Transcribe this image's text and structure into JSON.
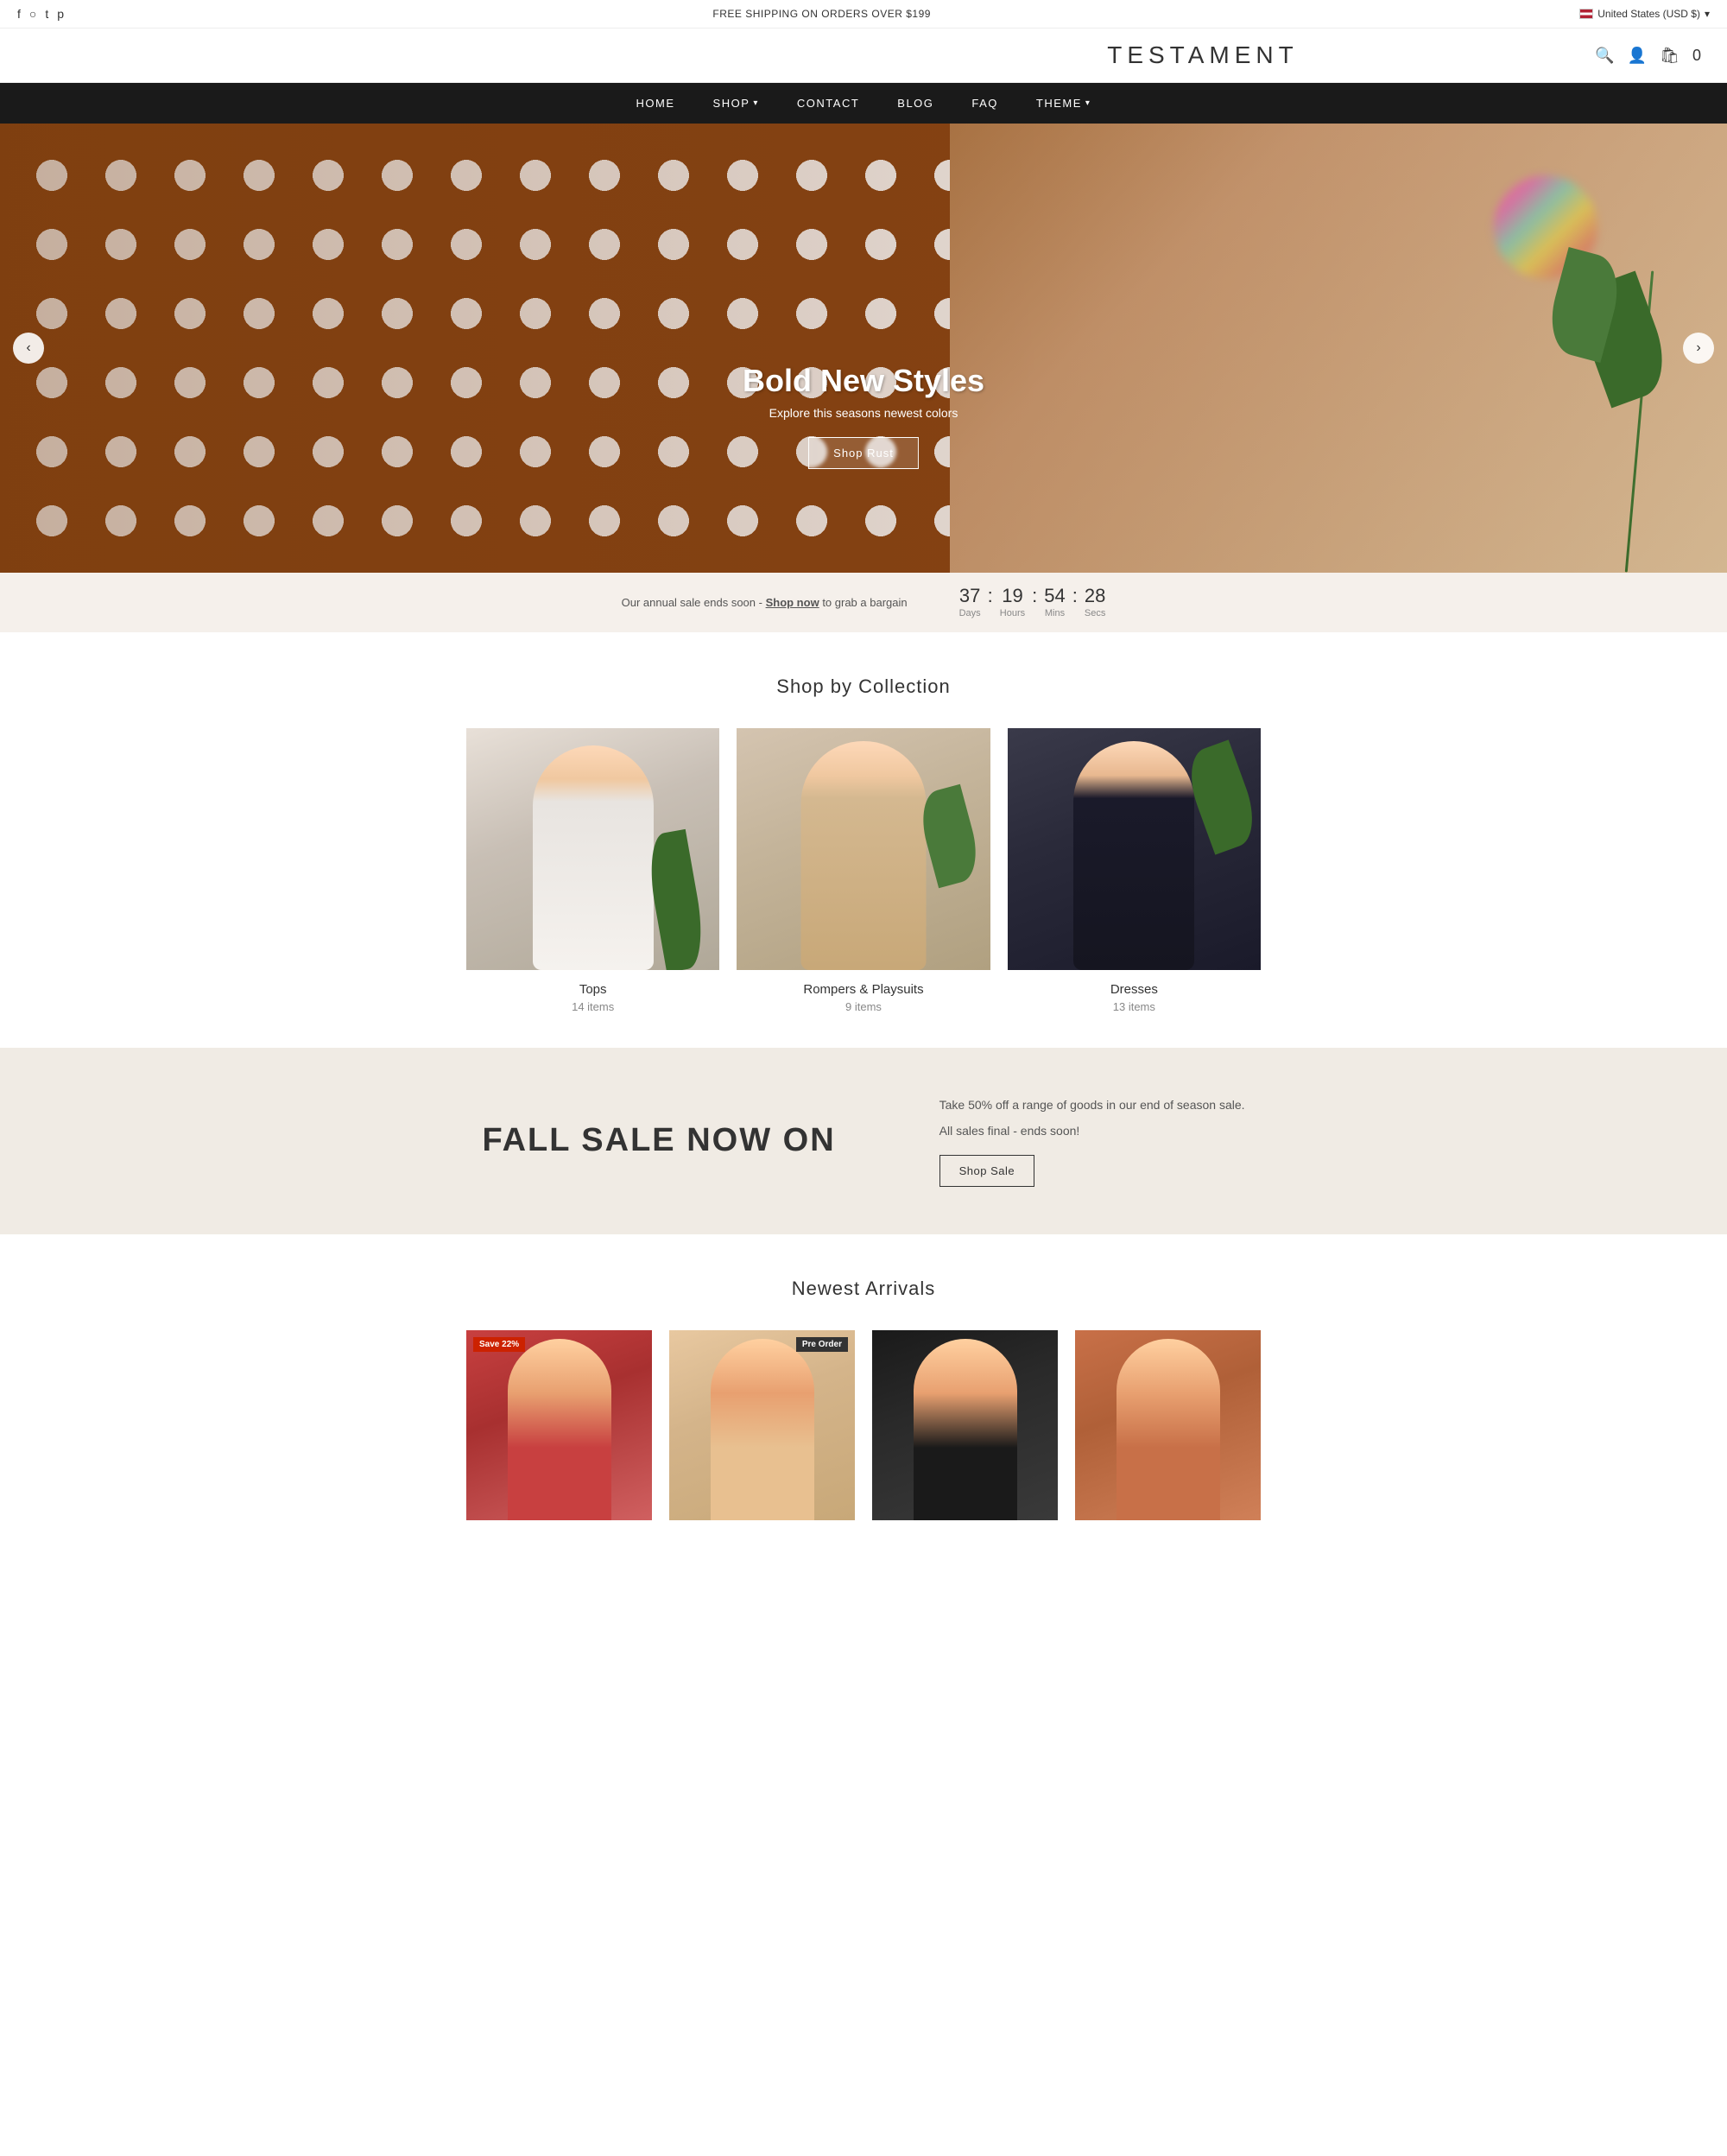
{
  "topbar": {
    "shipping_text": "FREE SHIPPING ON ORDERS OVER $199",
    "locale": "United States (USD $)",
    "social": [
      "facebook",
      "instagram",
      "twitter",
      "pinterest"
    ]
  },
  "header": {
    "logo": "TESTAMENT",
    "cart_count": "0"
  },
  "nav": {
    "items": [
      {
        "label": "HOME",
        "has_dropdown": false
      },
      {
        "label": "SHOP",
        "has_dropdown": true
      },
      {
        "label": "CONTACT",
        "has_dropdown": false
      },
      {
        "label": "BLOG",
        "has_dropdown": false
      },
      {
        "label": "FAQ",
        "has_dropdown": false
      },
      {
        "label": "THEME",
        "has_dropdown": true
      }
    ]
  },
  "hero": {
    "title": "Bold New Styles",
    "subtitle": "Explore this seasons newest colors",
    "cta_label": "Shop Rust"
  },
  "countdown": {
    "text": "Our annual sale ends soon -",
    "link_text": "Shop now",
    "link_suffix": "to grab a bargain",
    "days": "37",
    "hours": "19",
    "mins": "54",
    "secs": "28",
    "labels": {
      "days": "Days",
      "hours": "Hours",
      "mins": "Mins",
      "secs": "Secs"
    }
  },
  "collections": {
    "section_title": "Shop by Collection",
    "items": [
      {
        "name": "Tops",
        "count": "14 items"
      },
      {
        "name": "Rompers & Playsuits",
        "count": "9 items"
      },
      {
        "name": "Dresses",
        "count": "13 items"
      }
    ]
  },
  "fall_sale": {
    "title": "FALL SALE NOW ON",
    "description_1": "Take 50% off a range of goods in our end of season sale.",
    "description_2": "All sales final - ends soon!",
    "cta_label": "Shop Sale"
  },
  "arrivals": {
    "section_title": "Newest Arrivals",
    "items": [
      {
        "badge": "Save 22%",
        "badge_type": "sale"
      },
      {
        "badge": "Pre Order",
        "badge_type": "preorder"
      },
      {},
      {}
    ]
  }
}
